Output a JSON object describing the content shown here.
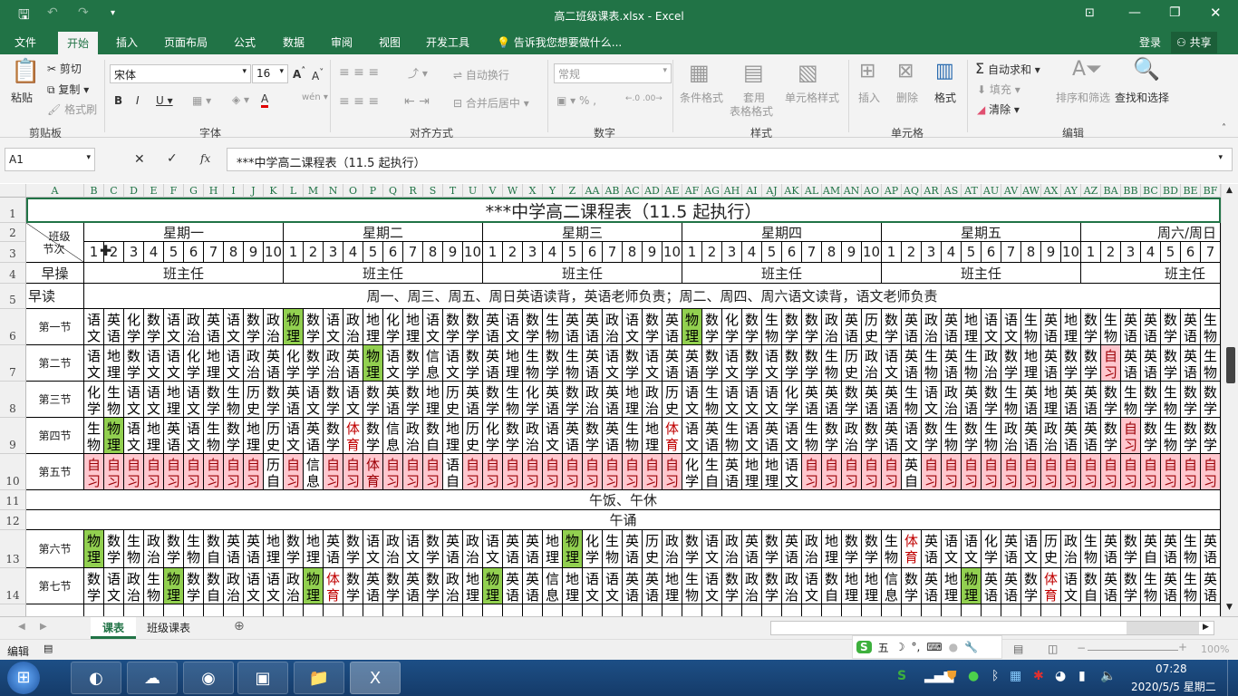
{
  "window": {
    "title": "高二班级课表.xlsx - Excel",
    "qat_more": "▾"
  },
  "tabs": [
    "文件",
    "开始",
    "插入",
    "页面布局",
    "公式",
    "数据",
    "审阅",
    "视图",
    "开发工具"
  ],
  "tell_me": "告诉我您想要做什么...",
  "login": "登录",
  "share": "共享",
  "ribbon": {
    "paste": "粘贴",
    "cut": "剪切",
    "copy": "复制",
    "format_painter": "格式刷",
    "clipboard": "剪贴板",
    "font_name": "宋体",
    "font_size": "16",
    "font_group": "字体",
    "wrap": "自动换行",
    "merge": "合并后居中",
    "align_group": "对齐方式",
    "number_format": "常规",
    "number_group": "数字",
    "cond_format": "条件格式",
    "table_format_1": "套用",
    "table_format_2": "表格格式",
    "cell_styles": "单元格样式",
    "styles_group": "样式",
    "insert": "插入",
    "delete": "删除",
    "format": "格式",
    "cells_group": "单元格",
    "autosum": "自动求和",
    "fill": "填充",
    "clear": "清除",
    "sort_filter": "排序和筛选",
    "find_select": "查找和选择",
    "edit_group": "编辑"
  },
  "formula_bar": {
    "name_box": "A1",
    "fx": "fx",
    "content": "***中学高二课程表（11.5 起执行）"
  },
  "column_headers": [
    "A",
    "B",
    "C",
    "D",
    "E",
    "F",
    "G",
    "H",
    "I",
    "J",
    "K",
    "L",
    "M",
    "N",
    "O",
    "P",
    "Q",
    "R",
    "S",
    "T",
    "U",
    "V",
    "W",
    "X",
    "Y",
    "Z",
    "AA",
    "AB",
    "AC",
    "AD",
    "AE",
    "AF",
    "AG",
    "AH",
    "AI",
    "AJ",
    "AK",
    "AL",
    "AM",
    "AN",
    "AO",
    "AP",
    "AQ",
    "AR",
    "AS",
    "AT",
    "AU",
    "AV",
    "AW",
    "AX",
    "AY",
    "AZ",
    "BA",
    "BB",
    "BC",
    "BD",
    "BE",
    "BF"
  ],
  "row_headers": [
    "1",
    "2",
    "3",
    "4",
    "5",
    "6",
    "7",
    "8",
    "9",
    "10",
    "11",
    "12",
    "13",
    "14",
    "15"
  ],
  "sheet": {
    "title": "***中学高二课程表（11.5 起执行）",
    "corner_top": "班级",
    "corner_bottom": "节次",
    "days": [
      "星期一",
      "星期二",
      "星期三",
      "星期四",
      "星期五",
      "周六/周日"
    ],
    "class_numbers": [
      "1",
      "2",
      "3",
      "4",
      "5",
      "6",
      "7",
      "8",
      "9",
      "10"
    ],
    "weekend_class_numbers": [
      "1",
      "2",
      "3",
      "4",
      "5",
      "6",
      "7"
    ],
    "morning_exercise": "早操",
    "homeroom": "班主任",
    "morning_reading": "早读",
    "morning_reading_note": "周一、周三、周五、周日英语读背，英语老师负责；周二、周四、周六语文读背，语文老师负责",
    "lunch": "午饭、午休",
    "noon_reading": "午诵",
    "periods": [
      {
        "label": "第一节",
        "cells": [
          "语文",
          "英语",
          "化学",
          "数学",
          "语文",
          "政治",
          "英语",
          "语文",
          "数学",
          "政治",
          "物理",
          "数学",
          "语文",
          "政治",
          "地理",
          "化学",
          "地理",
          "语文",
          "数学",
          "数学",
          "英语",
          "语文",
          "数学",
          "生物",
          "英语",
          "英语",
          "政治",
          "语文",
          "数学",
          "英语",
          "物理",
          "数学",
          "化学",
          "数学",
          "生物",
          "数学",
          "数学",
          "政治",
          "英语",
          "历史",
          "数学",
          "英语",
          "政治",
          "英语",
          "地理",
          "语文",
          "语文",
          "生物",
          "英语",
          "地理",
          "数学",
          "生物",
          "英语",
          "英语",
          "数学",
          "英语",
          "生物"
        ]
      },
      {
        "label": "第二节",
        "cells": [
          "语文",
          "地理",
          "数学",
          "语文",
          "语文",
          "化学",
          "地理",
          "语文",
          "政治",
          "英语",
          "化学",
          "数学",
          "政治",
          "英语",
          "物理",
          "语文",
          "数学",
          "信息",
          "语文",
          "数学",
          "英语",
          "地理",
          "生物",
          "数学",
          "生物",
          "英语",
          "语文",
          "数学",
          "语文",
          "英语",
          "英语",
          "数学",
          "语文",
          "数学",
          "语文",
          "数学",
          "数学",
          "生物",
          "历史",
          "政治",
          "语文",
          "英语",
          "生物",
          "英语",
          "生物",
          "政治",
          "数学",
          "地理",
          "英语",
          "数学",
          "数学",
          "自习",
          "英语",
          "英语",
          "数学",
          "英语",
          "生物"
        ]
      },
      {
        "label": "第三节",
        "cells": [
          "化学",
          "生物",
          "语文",
          "语文",
          "地理",
          "语文",
          "数学",
          "生物",
          "历史",
          "数学",
          "英语",
          "语文",
          "数学",
          "语文",
          "数学",
          "英语",
          "数学",
          "地理",
          "历史",
          "英语",
          "数学",
          "生物",
          "化学",
          "英语",
          "数学",
          "政治",
          "英语",
          "地理",
          "政治",
          "历史",
          "语文",
          "生物",
          "语文",
          "语文",
          "语文",
          "化学",
          "英语",
          "英语",
          "数学",
          "英语",
          "英语",
          "生物",
          "语文",
          "政治",
          "英语",
          "数学",
          "生物",
          "英语",
          "地理",
          "英语",
          "英语",
          "数学",
          "生物",
          "数学",
          "生物",
          "数学",
          "数学"
        ]
      },
      {
        "label": "第四节",
        "cells": [
          "生物",
          "物理",
          "语文",
          "地理",
          "英语",
          "语文",
          "生物",
          "数学",
          "地理",
          "历史",
          "语文",
          "英语",
          "数学",
          "体育",
          "数学",
          "信息",
          "政治",
          "数自",
          "地理",
          "历史",
          "化学",
          "数学",
          "政治",
          "语文",
          "英语",
          "数学",
          "英语",
          "生物",
          "地理",
          "体育",
          "语文",
          "英语",
          "生物",
          "语文",
          "英语",
          "语文",
          "生物",
          "数学",
          "政治",
          "数学",
          "英语",
          "语文",
          "数学",
          "生物",
          "数学",
          "生物",
          "政治",
          "英语",
          "政治",
          "英语",
          "英语",
          "数学",
          "自习",
          "数学",
          "生物",
          "数学",
          "数学"
        ]
      },
      {
        "label": "第五节",
        "cells": [
          "自习",
          "自习",
          "自习",
          "自习",
          "自习",
          "自习",
          "自习",
          "自习",
          "自习",
          "历自",
          "自习",
          "信息",
          "自习",
          "自习",
          "体育",
          "自习",
          "自习",
          "自习",
          "语自",
          "自习",
          "自习",
          "自习",
          "自习",
          "自习",
          "自习",
          "自习",
          "自习",
          "自习",
          "自习",
          "自习",
          "化学",
          "生自",
          "英语",
          "地理",
          "地理",
          "语文",
          "自习",
          "自习",
          "自习",
          "自习",
          "自习",
          "英自",
          "自习",
          "自习",
          "自习",
          "自习",
          "自习",
          "自习",
          "自习",
          "自习",
          "自习",
          "自习",
          "自习",
          "自习",
          "自习",
          "自习",
          "自习"
        ],
        "pink_cells": [
          "P"
        ]
      },
      {
        "label": "第六节",
        "cells": [
          "物理",
          "数学",
          "生物",
          "政治",
          "数学",
          "生物",
          "数自",
          "英语",
          "英语",
          "地理",
          "数学",
          "地理",
          "英语",
          "数学",
          "语文",
          "政治",
          "语文",
          "数学",
          "英语",
          "政治",
          "语文",
          "英语",
          "英语",
          "地理",
          "物理",
          "化学",
          "生物",
          "英语",
          "历史",
          "政治",
          "数学",
          "语文",
          "政治",
          "英语",
          "数学",
          "英语",
          "政治",
          "地理",
          "数学",
          "数学",
          "生物",
          "体育",
          "英语",
          "语文",
          "语文",
          "化学",
          "英语",
          "语文",
          "历史",
          "政治",
          "生物",
          "英语",
          "数学",
          "英自",
          "英语",
          "生物",
          "英语"
        ]
      },
      {
        "label": "第七节",
        "cells": [
          "数学",
          "语文",
          "政治",
          "生物",
          "物理",
          "数学",
          "数自",
          "政治",
          "语文",
          "语文",
          "政治",
          "物理",
          "体育",
          "数学",
          "英语",
          "数学",
          "英语",
          "数学",
          "政治",
          "地理",
          "物理",
          "英语",
          "英语",
          "信息",
          "地理",
          "语文",
          "语文",
          "英语",
          "英语",
          "地理",
          "生物",
          "语文",
          "数学",
          "政治",
          "数学",
          "政治",
          "语文",
          "数自",
          "地理",
          "地理",
          "信息",
          "数学",
          "英语",
          "地理",
          "物理",
          "英语",
          "英语",
          "数学",
          "体育",
          "语文",
          "数自",
          "英语",
          "数学",
          "生物",
          "英语",
          "生物",
          "英语"
        ]
      }
    ]
  },
  "colors": {
    "excel_green": "#217346",
    "physics_fill": "#92d050",
    "study_fill": "#ffc7ce",
    "study_text": "#9c0006",
    "pe_text": "#c00000"
  },
  "sheet_tabs": [
    "课表",
    "班级课表"
  ],
  "status": {
    "mode": "编辑",
    "zoom": "100%",
    "ime": [
      "五",
      "☽",
      "°,"
    ]
  },
  "taskbar": {
    "time": "07:28",
    "date": "2020/5/5 星期二"
  }
}
